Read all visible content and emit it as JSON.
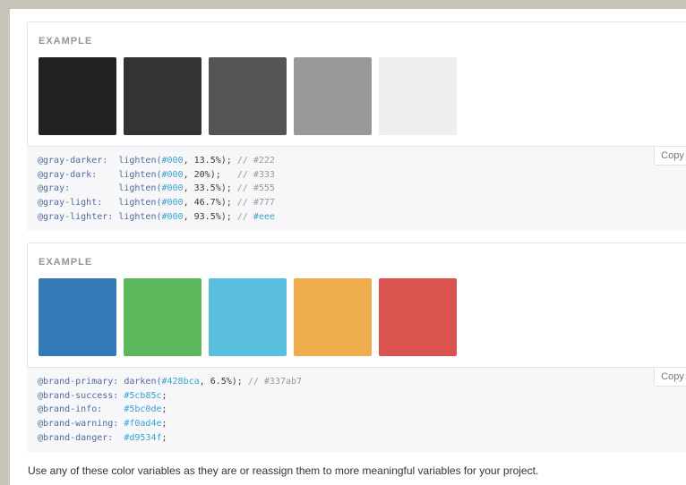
{
  "example_label": "EXAMPLE",
  "copy_label": "Copy",
  "gray_section": {
    "swatches": [
      {
        "name": "gray-darker",
        "color": "#222222"
      },
      {
        "name": "gray-dark",
        "color": "#333333"
      },
      {
        "name": "gray",
        "color": "#555555"
      },
      {
        "name": "gray-light",
        "color": "#999999"
      },
      {
        "name": "gray-lighter",
        "color": "#eeeeee"
      }
    ],
    "code_lines": [
      {
        "var": "@gray-darker:",
        "pad": "  ",
        "func": "lighten(",
        "hex": "#000",
        "rest": ", 13.5%); ",
        "comment": "// #222",
        "comment_hex": ""
      },
      {
        "var": "@gray-dark:",
        "pad": "    ",
        "func": "lighten(",
        "hex": "#000",
        "rest": ", 20%);   ",
        "comment": "// #333",
        "comment_hex": ""
      },
      {
        "var": "@gray:",
        "pad": "         ",
        "func": "lighten(",
        "hex": "#000",
        "rest": ", 33.5%); ",
        "comment": "// #555",
        "comment_hex": ""
      },
      {
        "var": "@gray-light:",
        "pad": "   ",
        "func": "lighten(",
        "hex": "#000",
        "rest": ", 46.7%); ",
        "comment": "// #777",
        "comment_hex": ""
      },
      {
        "var": "@gray-lighter:",
        "pad": " ",
        "func": "lighten(",
        "hex": "#000",
        "rest": ", 93.5%); ",
        "comment": "// ",
        "comment_hex": "#eee"
      }
    ]
  },
  "brand_section": {
    "swatches": [
      {
        "name": "brand-primary",
        "color": "#337ab7"
      },
      {
        "name": "brand-success",
        "color": "#5cb85c"
      },
      {
        "name": "brand-info",
        "color": "#5bc0de"
      },
      {
        "name": "brand-warning",
        "color": "#f0ad4e"
      },
      {
        "name": "brand-danger",
        "color": "#d9534f"
      }
    ],
    "code_lines": [
      {
        "var": "@brand-primary:",
        "pad": " ",
        "func": "darken(",
        "hex": "#428bca",
        "rest": ", 6.5%); ",
        "comment": "// #337ab7",
        "comment_hex": ""
      },
      {
        "var": "@brand-success:",
        "pad": " ",
        "func": "",
        "hex": "#5cb85c",
        "rest": ";",
        "comment": "",
        "comment_hex": ""
      },
      {
        "var": "@brand-info:",
        "pad": "    ",
        "func": "",
        "hex": "#5bc0de",
        "rest": ";",
        "comment": "",
        "comment_hex": ""
      },
      {
        "var": "@brand-warning:",
        "pad": " ",
        "func": "",
        "hex": "#f0ad4e",
        "rest": ";",
        "comment": "",
        "comment_hex": ""
      },
      {
        "var": "@brand-danger:",
        "pad": "  ",
        "func": "",
        "hex": "#d9534f",
        "rest": ";",
        "comment": "",
        "comment_hex": ""
      }
    ]
  },
  "footer_text": "Use any of these color variables as they are or reassign them to more meaningful variables for your project."
}
